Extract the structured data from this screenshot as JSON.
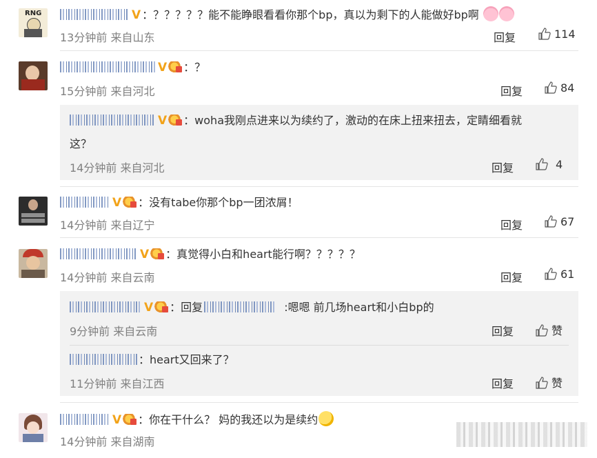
{
  "colors": {
    "name": "#6b86b8",
    "meta": "#808080",
    "vip": "#f2a31a",
    "reply_bg": "#f2f2f2"
  },
  "actions": {
    "reply": "回复",
    "like": "赞"
  },
  "comments": [
    {
      "text": "：？？？？？能不能睁眼看看你那个bp，真以为剩下的人能做好bp啊",
      "meta": "13分钟前 来自山东",
      "likes": "114",
      "avatar_text": "RNG"
    },
    {
      "text": "：？",
      "meta": "15分钟前 来自河北",
      "likes": "84",
      "replies": [
        {
          "text": "：woha我刚点进来以为续约了，激动的在床上扭来扭去，定睛细看就",
          "text2": "这？",
          "meta": "14分钟前 来自河北",
          "likes": "4"
        }
      ]
    },
    {
      "text": "：没有tabe你那个bp一团浓屑！",
      "meta": "14分钟前 来自辽宁",
      "likes": "67"
    },
    {
      "text": "：真觉得小白和heart能行啊？？？？？",
      "meta": "14分钟前 来自云南",
      "likes": "61",
      "replies": [
        {
          "prefix": "：回复",
          "text": ":嗯嗯 前几场heart和小白bp的",
          "meta": "9分钟前 来自云南"
        },
        {
          "text": "：heart又回来了？",
          "meta": "11分钟前 来自江西"
        }
      ]
    },
    {
      "text": "：你在干什么？ 妈的我还以为是续约",
      "meta": "14分钟前 来自湖南"
    }
  ]
}
